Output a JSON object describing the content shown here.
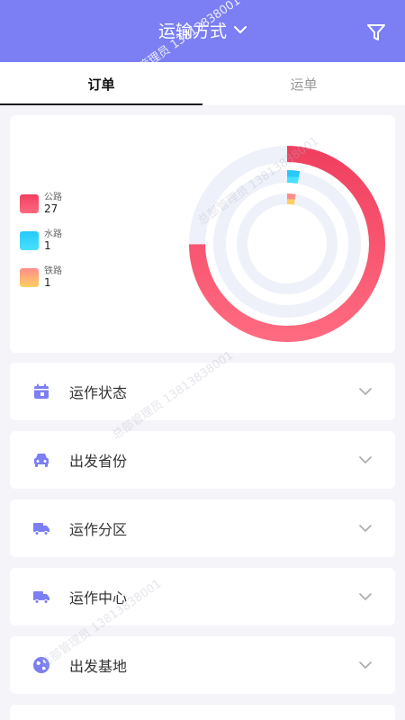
{
  "header": {
    "title": "运输方式"
  },
  "tabs": [
    {
      "label": "订单",
      "active": true
    },
    {
      "label": "运单",
      "active": false
    }
  ],
  "chart_data": {
    "type": "pie",
    "series": [
      {
        "name": "公路",
        "value": 27,
        "color_start": "#f04060",
        "color_end": "#ff6a80"
      },
      {
        "name": "水路",
        "value": 1,
        "color_start": "#28c8f8",
        "color_end": "#48e0ff"
      },
      {
        "name": "铁路",
        "value": 1,
        "color_start": "#ff8c8c",
        "color_end": "#ffd060"
      }
    ],
    "legend_position": "left"
  },
  "rows": [
    {
      "label": "运作状态",
      "icon": "calendar-icon"
    },
    {
      "label": "出发省份",
      "icon": "car-icon"
    },
    {
      "label": "运作分区",
      "icon": "truck-icon"
    },
    {
      "label": "运作中心",
      "icon": "truck-icon"
    },
    {
      "label": "出发基地",
      "icon": "globe-icon"
    }
  ],
  "watermark": {
    "text": "总部管理员  13813838001"
  },
  "colors": {
    "accent": "#7b7ff3",
    "icon": "#7b7ff3",
    "ring_track": "#eef1f9"
  }
}
